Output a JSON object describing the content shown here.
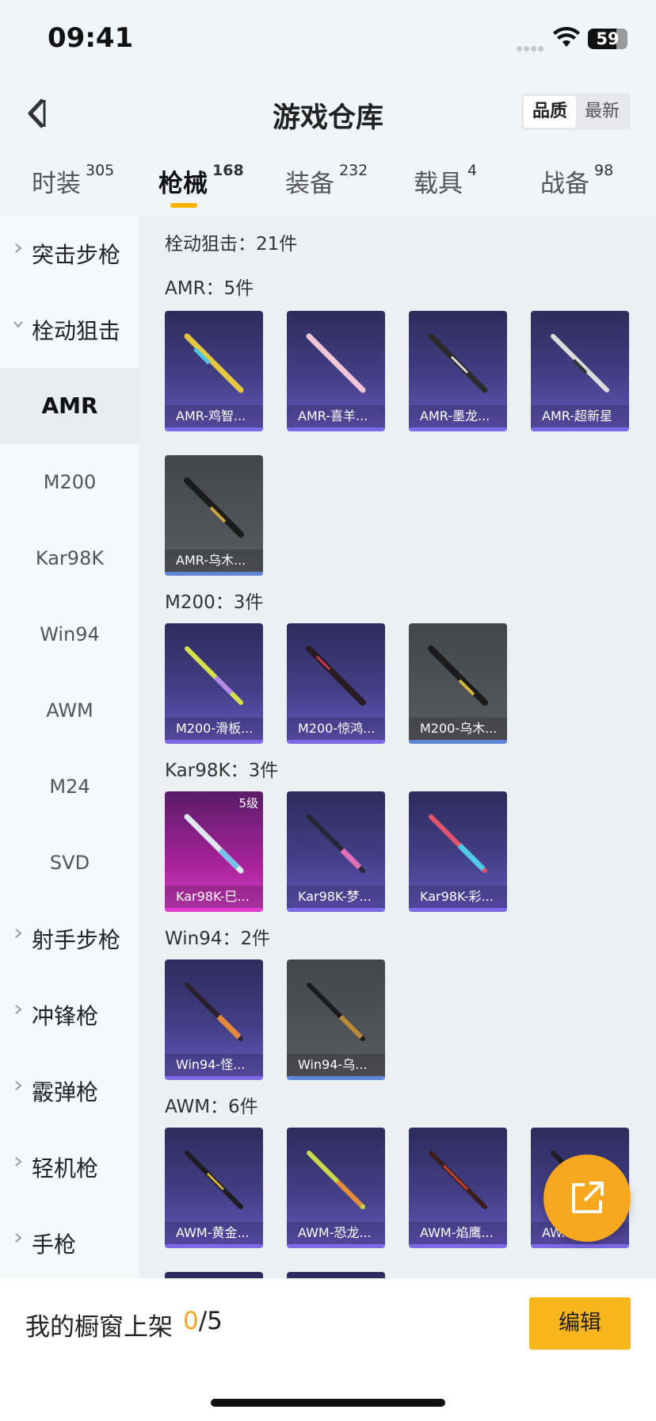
{
  "status": {
    "time": "09:41",
    "battery": "59"
  },
  "header": {
    "title": "游戏仓库",
    "sort_quality": "品质",
    "sort_newest": "最新"
  },
  "tabs": [
    {
      "label": "时装",
      "count": "305"
    },
    {
      "label": "枪械",
      "count": "168"
    },
    {
      "label": "装备",
      "count": "232"
    },
    {
      "label": "载具",
      "count": "4"
    },
    {
      "label": "战备",
      "count": "98"
    }
  ],
  "sidebar": {
    "groups": [
      "突击步枪",
      "栓动狙击",
      "射手步枪",
      "冲锋枪",
      "霰弹枪",
      "轻机枪",
      "手枪"
    ],
    "subs": [
      "AMR",
      "M200",
      "Kar98K",
      "Win94",
      "AWM",
      "M24",
      "SVD"
    ]
  },
  "content": {
    "category_title": "栓动狙击：21件",
    "sections": [
      {
        "title": "AMR：5件",
        "items": [
          "AMR-鸡智...",
          "AMR-喜羊...",
          "AMR-墨龙...",
          "AMR-超新星",
          "AMR-乌木..."
        ]
      },
      {
        "title": "M200：3件",
        "items": [
          "M200-滑板...",
          "M200-惊鸿...",
          "M200-乌木..."
        ]
      },
      {
        "title": "Kar98K：3件",
        "items": [
          "Kar98K-巳...",
          "Kar98K-梦...",
          "Kar98K-彩..."
        ],
        "level": "5级"
      },
      {
        "title": "Win94：2件",
        "items": [
          "Win94-怪...",
          "Win94-乌..."
        ]
      },
      {
        "title": "AWM：6件",
        "items": [
          "AWM-黄金...",
          "AWM-恐龙...",
          "AWM-焰鹰...",
          "AW..."
        ]
      }
    ]
  },
  "bottom": {
    "showcase_label": "我的橱窗上架",
    "current": "0",
    "total": "/5",
    "edit": "编辑"
  },
  "colors": {
    "accent": "#f9b51c",
    "purple_card": "#423f86",
    "gray_card": "#5a5a62",
    "pink_card": "#a7229a"
  }
}
